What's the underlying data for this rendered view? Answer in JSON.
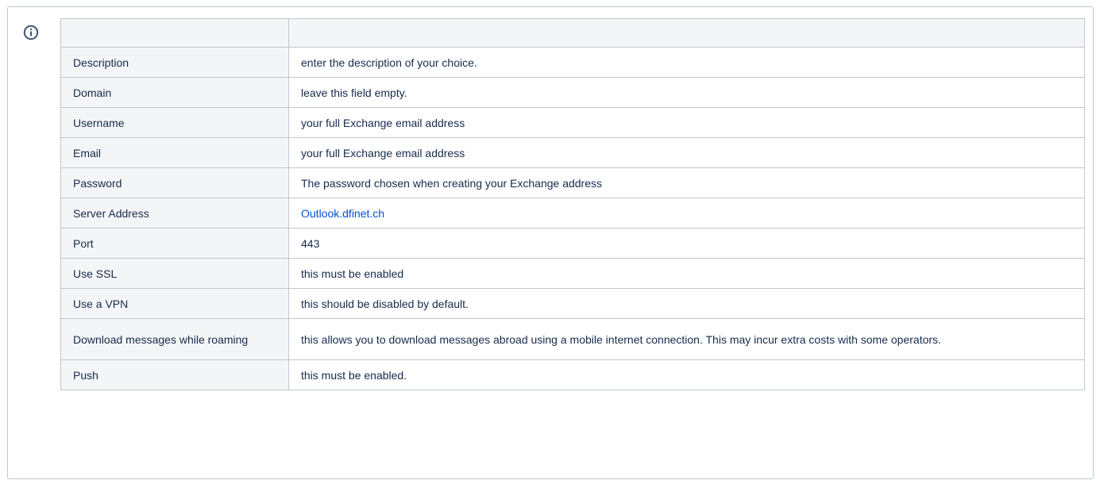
{
  "info_icon": {
    "name": "info-icon",
    "color": "#42526e"
  },
  "table": {
    "header": [
      "",
      ""
    ],
    "rows": [
      {
        "label": "Description",
        "value": "enter the description of your choice."
      },
      {
        "label": "Domain",
        "value": "leave this field empty."
      },
      {
        "label": "Username",
        "value": "your full Exchange email address"
      },
      {
        "label": "Email",
        "value": "your full Exchange email address"
      },
      {
        "label": "Password",
        "value": "The password chosen when creating your Exchange address"
      },
      {
        "label": "Server Address",
        "value": "Outlook.dfinet.ch"
      },
      {
        "label": "Port",
        "value": "443"
      },
      {
        "label": "Use SSL",
        "value": "this must be enabled"
      },
      {
        "label": "Use a VPN",
        "value": "this should be disabled by default."
      },
      {
        "label": "Download messages while roaming",
        "value": "this allows you to download messages abroad using a mobile internet connection. This may incur extra costs with some operators."
      },
      {
        "label": "Push",
        "value": "this must be enabled."
      }
    ]
  },
  "colors": {
    "border": "#c1c7d0",
    "header_bg": "#f4f5f7",
    "link": "#0052cc",
    "text": "#172b4d"
  }
}
